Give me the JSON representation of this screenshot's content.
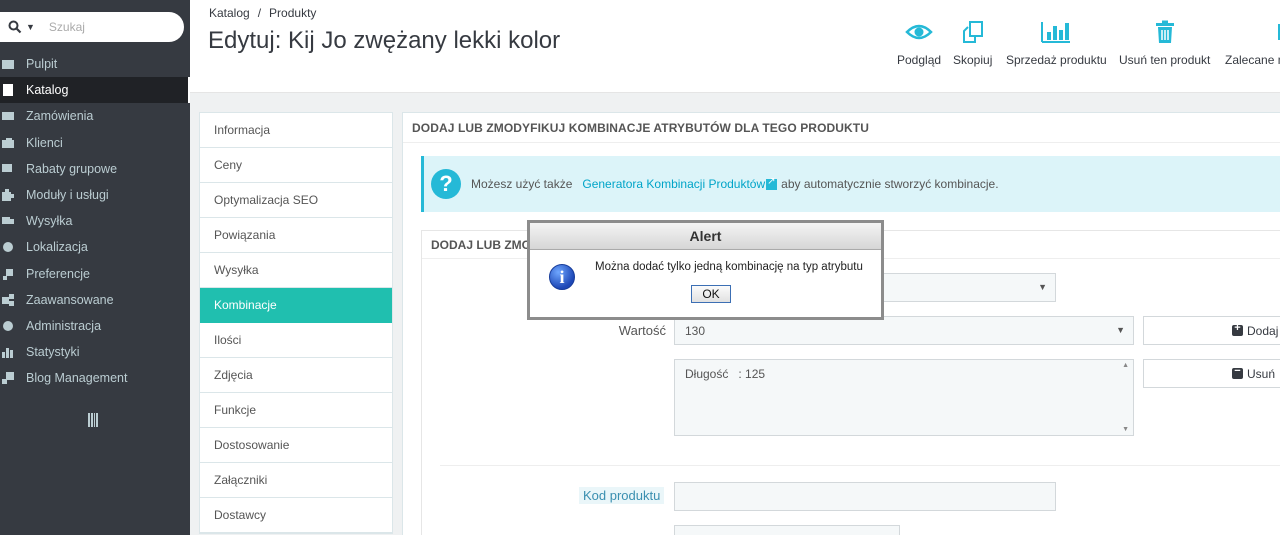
{
  "sidebar": {
    "search_placeholder": "Szukaj",
    "items": [
      {
        "label": "Pulpit",
        "icon": "dashboard-icon",
        "active": false
      },
      {
        "label": "Katalog",
        "icon": "book-icon",
        "active": true
      },
      {
        "label": "Zamówienia",
        "icon": "credit-card-icon",
        "active": false
      },
      {
        "label": "Klienci",
        "icon": "users-icon",
        "active": false
      },
      {
        "label": "Rabaty grupowe",
        "icon": "tags-icon",
        "active": false
      },
      {
        "label": "Moduły i usługi",
        "icon": "puzzle-icon",
        "active": false
      },
      {
        "label": "Wysyłka",
        "icon": "truck-icon",
        "active": false
      },
      {
        "label": "Lokalizacja",
        "icon": "globe-icon",
        "active": false
      },
      {
        "label": "Preferencje",
        "icon": "wrench-icon",
        "active": false
      },
      {
        "label": "Zaawansowane",
        "icon": "cogs-icon",
        "active": false
      },
      {
        "label": "Administracja",
        "icon": "cog-icon",
        "active": false
      },
      {
        "label": "Statystyki",
        "icon": "bar-chart-icon",
        "active": false
      },
      {
        "label": "Blog Management",
        "icon": "pencil-icon",
        "active": false
      }
    ]
  },
  "header": {
    "breadcrumb": [
      "Katalog",
      "Produkty"
    ],
    "title": "Edytuj: Kij Jo zwężany lekki kolor",
    "toolbar": [
      {
        "label": "Podgląd",
        "icon": "eye-icon"
      },
      {
        "label": "Skopiuj",
        "icon": "copy-icon"
      },
      {
        "label": "Sprzedaż produktu",
        "icon": "bar-chart-icon"
      },
      {
        "label": "Usuń ten produkt",
        "icon": "trash-icon"
      },
      {
        "label": "Zalecane m",
        "icon": "partial-icon"
      }
    ]
  },
  "tabs": [
    {
      "label": "Informacja",
      "active": false
    },
    {
      "label": "Ceny",
      "active": false
    },
    {
      "label": "Optymalizacja SEO",
      "active": false
    },
    {
      "label": "Powiązania",
      "active": false
    },
    {
      "label": "Wysyłka",
      "active": false
    },
    {
      "label": "Kombinacje",
      "active": true
    },
    {
      "label": "Ilości",
      "active": false
    },
    {
      "label": "Zdjęcia",
      "active": false
    },
    {
      "label": "Funkcje",
      "active": false
    },
    {
      "label": "Dostosowanie",
      "active": false
    },
    {
      "label": "Załączniki",
      "active": false
    },
    {
      "label": "Dostawcy",
      "active": false
    }
  ],
  "panel": {
    "heading": "DODAJ LUB ZMODYFIKUJ KOMBINACJE ATRYBUTÓW DLA TEGO PRODUKTU",
    "info": {
      "before": "Możesz użyć także",
      "link": "Generatora Kombinacji Produktów",
      "after": "aby automatycznie stworzyć kombinacje."
    },
    "inner_heading": "DODAJ LUB ZMODY",
    "wartosc_label": "Wartość",
    "wartosc_value": "130",
    "add_button": "Dodaj",
    "remove_button": "Usuń",
    "combination_list": "Długość   : 125",
    "kod_label": "Kod produktu"
  },
  "alert": {
    "title": "Alert",
    "message": "Można dodać tylko jedną kombinację na typ atrybutu",
    "ok": "OK"
  },
  "colors": {
    "sidebar_bg": "#363a41",
    "accent": "#25b9d7",
    "active_tab": "#20bfaf"
  }
}
